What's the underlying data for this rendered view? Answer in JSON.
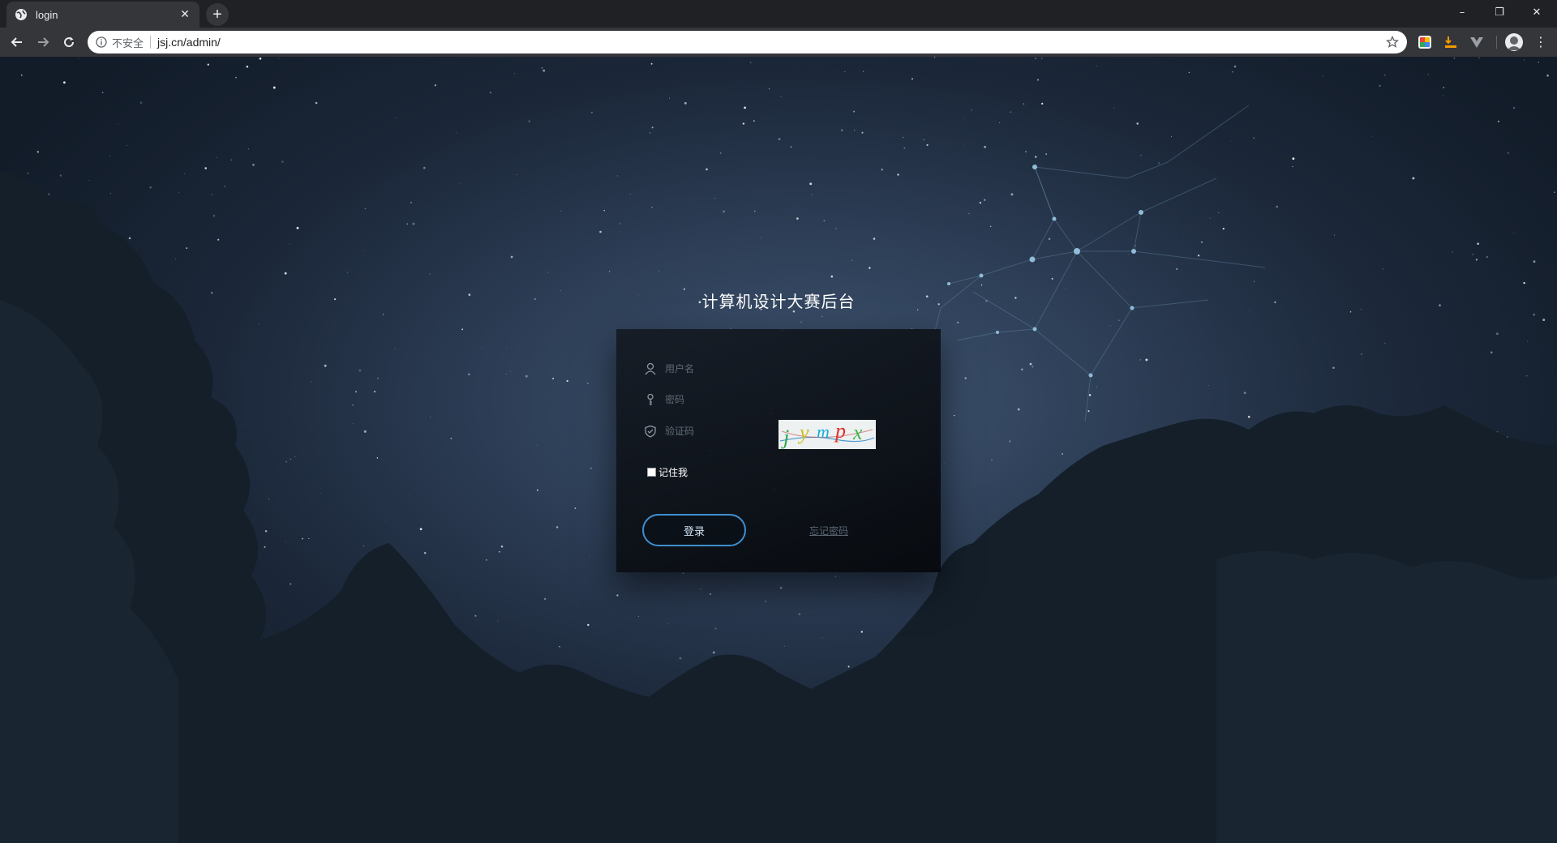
{
  "browser": {
    "tab_title": "login",
    "new_tab_label": "+",
    "security_label": "不安全",
    "url": "jsj.cn/admin/",
    "window_controls": {
      "minimize": "–",
      "maximize": "❐",
      "close": "✕"
    },
    "tab_close": "✕",
    "menu": "⋮"
  },
  "page": {
    "title": "计算机设计大赛后台",
    "form": {
      "username_placeholder": "用户名",
      "password_placeholder": "密码",
      "captcha_placeholder": "验证码",
      "captcha_text": "jympx",
      "remember_label": "记住我",
      "login_button": "登录",
      "forgot_link": "忘记密码"
    }
  },
  "colors": {
    "accent": "#3e8fd0",
    "chrome_dark": "#202124",
    "chrome_toolbar": "#35363a"
  },
  "icons": {
    "tab": "globe-icon",
    "back": "arrow-left-icon",
    "forward": "arrow-right-icon",
    "reload": "reload-icon",
    "info": "info-icon",
    "bookmark": "star-icon",
    "username": "user-icon",
    "password": "key-icon",
    "captcha": "shield-icon"
  }
}
